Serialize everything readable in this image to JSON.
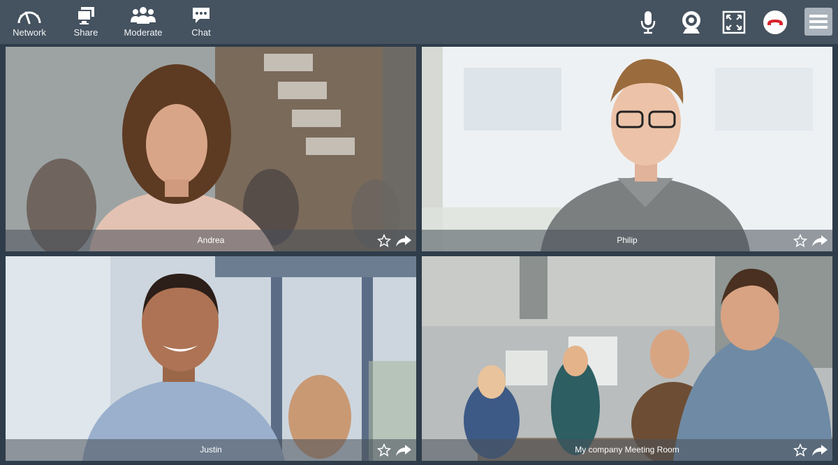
{
  "toolbar": {
    "left_items": [
      {
        "label": "Network",
        "icon": "gauge-icon"
      },
      {
        "label": "Share",
        "icon": "screen-share-icon"
      },
      {
        "label": "Moderate",
        "icon": "group-icon"
      },
      {
        "label": "Chat",
        "icon": "chat-bubble-icon"
      }
    ],
    "right_items": [
      {
        "icon": "microphone-icon"
      },
      {
        "icon": "webcam-icon"
      },
      {
        "icon": "fullscreen-icon"
      },
      {
        "icon": "hang-up-icon",
        "color": "#d6252b"
      },
      {
        "icon": "hamburger-menu-icon"
      }
    ]
  },
  "participants": [
    {
      "name": "Andrea"
    },
    {
      "name": "Philip"
    },
    {
      "name": "Justin"
    },
    {
      "name": "My company Meeting Room"
    }
  ],
  "colors": {
    "background": "#2f3d4b",
    "toolbar": "#45525f",
    "hang_up": "#d6252b",
    "menu_button": "#aab3bc"
  }
}
